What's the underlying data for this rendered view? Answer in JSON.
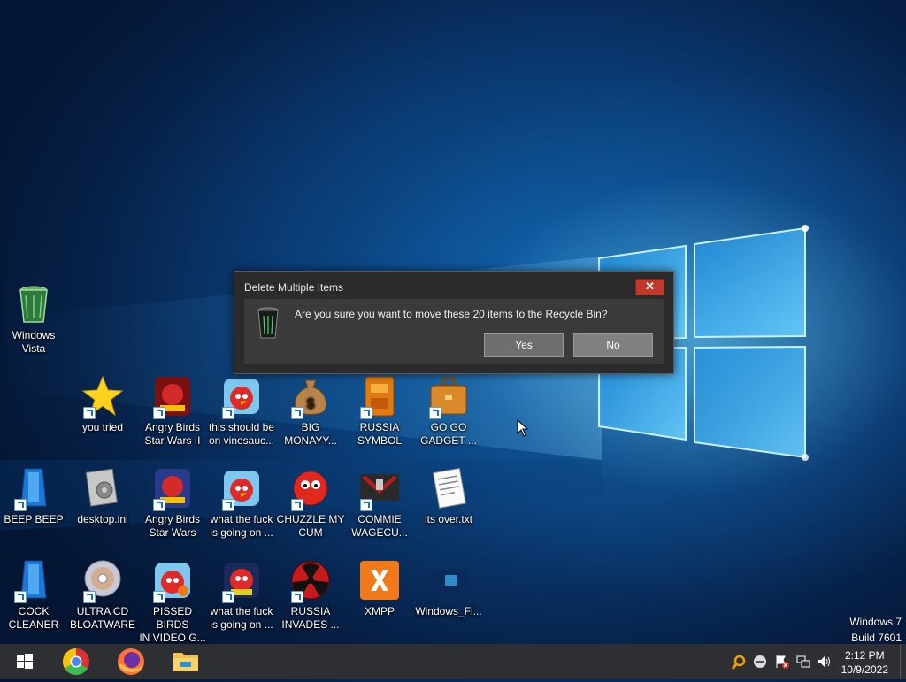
{
  "desktop": {
    "icons": [
      {
        "label_1": "Windows",
        "label_2": "Vista",
        "icon": "recycle-bin-icon"
      },
      {
        "label_1": "you tried",
        "label_2": "",
        "icon": "star-icon"
      },
      {
        "label_1": "Angry Birds",
        "label_2": "Star Wars II",
        "icon": "angry-birds-star-wars-ii-icon"
      },
      {
        "label_1": "this should be",
        "label_2": "on vinesauc...",
        "icon": "angry-birds-icon"
      },
      {
        "label_1": "BIG",
        "label_2": "MONAYY...",
        "icon": "money-bag-icon"
      },
      {
        "label_1": "RUSSIA",
        "label_2": "SYMBOL",
        "icon": "orange-block-icon"
      },
      {
        "label_1": "GO GO",
        "label_2": "GADGET ...",
        "icon": "briefcase-icon"
      },
      {
        "label_1": "BEEP BEEP",
        "label_2": "",
        "icon": "blue-device-icon"
      },
      {
        "label_1": "desktop.ini",
        "label_2": "",
        "icon": "settings-file-icon"
      },
      {
        "label_1": "Angry Birds",
        "label_2": "Star Wars",
        "icon": "angry-birds-star-wars-icon"
      },
      {
        "label_1": "what the fuck",
        "label_2": "is going on ...",
        "icon": "angry-birds-icon"
      },
      {
        "label_1": "CHUZZLE MY",
        "label_2": "CUM",
        "icon": "chuzzle-icon"
      },
      {
        "label_1": "COMMIE",
        "label_2": "WAGECU...",
        "icon": "eagle-flag-icon"
      },
      {
        "label_1": "its over.txt",
        "label_2": "",
        "icon": "text-file-icon"
      },
      {
        "label_1": "COCK",
        "label_2": "CLEANER",
        "icon": "blue-device-icon"
      },
      {
        "label_1": "ULTRA CD",
        "label_2": "BLOATWARE",
        "icon": "cd-icon"
      },
      {
        "label_1": "PISSED BIRDS",
        "label_2": "IN VIDEO G...",
        "icon": "angry-birds-icon"
      },
      {
        "label_1": "what the fuck",
        "label_2": "is going on ...",
        "icon": "angry-birds-space-icon"
      },
      {
        "label_1": "RUSSIA",
        "label_2": "INVADES ...",
        "icon": "radiation-icon"
      },
      {
        "label_1": "XMPP",
        "label_2": "",
        "icon": "xampp-icon"
      },
      {
        "label_1": "Windows_Fi...",
        "label_2": "",
        "icon": "wallpaper-image-icon"
      }
    ]
  },
  "dialog": {
    "title": "Delete Multiple Items",
    "close_label": "✕",
    "message": "Are you sure you want to move these 20 items to the Recycle Bin?",
    "yes_label": "Yes",
    "no_label": "No"
  },
  "watermark": {
    "line1": "Windows 7",
    "line2": "Build 7601"
  },
  "taskbar": {
    "pinned": [
      "start-icon",
      "chrome-icon",
      "firefox-icon",
      "file-explorer-icon"
    ],
    "clock_time": "2:12 PM",
    "clock_date": "10/9/2022"
  },
  "colors": {
    "taskbar_bg": "#2e2f32",
    "dialog_bg": "#2b2b2b",
    "close_red": "#c0392b"
  }
}
